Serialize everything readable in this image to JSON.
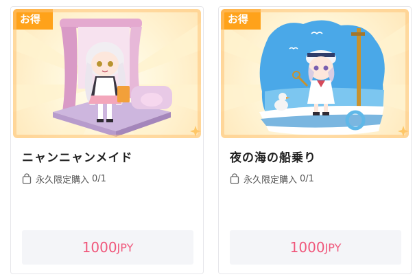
{
  "cards": [
    {
      "badge": "お得",
      "title": "ニャンニャンメイド",
      "limit_label": "永久限定購入",
      "limit_count": "0/1",
      "price": "1000",
      "currency": "JPY",
      "icon": "bag-icon",
      "colors": {
        "badge": "#ffa21a",
        "price": "#f0577b"
      }
    },
    {
      "badge": "お得",
      "title": "夜の海の船乗り",
      "limit_label": "永久限定購入",
      "limit_count": "0/1",
      "price": "1000",
      "currency": "JPY",
      "icon": "bag-icon",
      "colors": {
        "badge": "#ffa21a",
        "price": "#f0577b"
      }
    }
  ]
}
